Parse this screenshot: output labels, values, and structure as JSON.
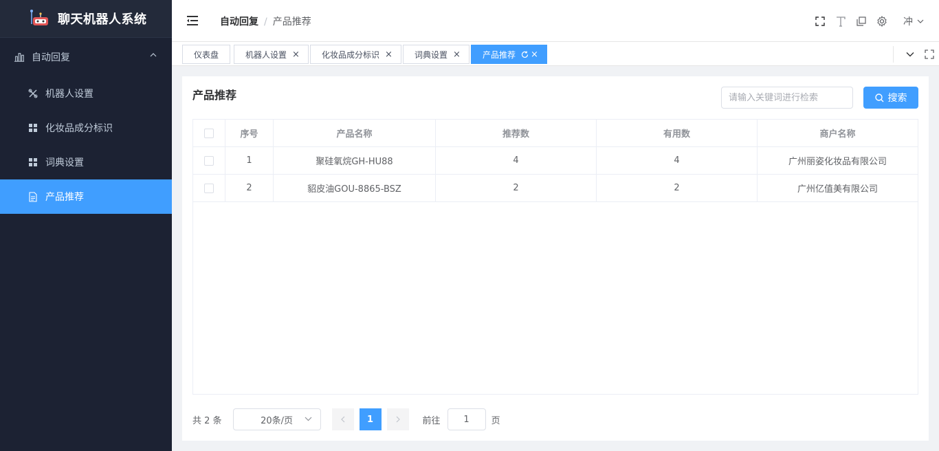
{
  "app": {
    "title": "聊天机器人系统"
  },
  "sidebar": {
    "group": {
      "label": "自动回复"
    },
    "items": [
      {
        "label": "机器人设置",
        "icon": "wrench-icon"
      },
      {
        "label": "化妆品成分标识",
        "icon": "grid-icon"
      },
      {
        "label": "词典设置",
        "icon": "grid-icon"
      },
      {
        "label": "产品推荐",
        "icon": "document-icon",
        "active": true
      }
    ]
  },
  "header": {
    "breadcrumb": [
      "自动回复",
      "产品推荐"
    ],
    "breadcrumb_sep": "/",
    "user": "冲"
  },
  "tags": [
    {
      "label": "仪表盘"
    },
    {
      "label": "机器人设置",
      "close": "×"
    },
    {
      "label": "化妆品成分标识",
      "close": "×"
    },
    {
      "label": "词典设置",
      "close": "×"
    },
    {
      "label": "产品推荐",
      "close": "×",
      "active": true
    }
  ],
  "main": {
    "title": "产品推荐",
    "search": {
      "placeholder": "请输入关键词进行检索",
      "button": "搜索"
    },
    "table": {
      "headers": [
        "序号",
        "产品名称",
        "推荐数",
        "有用数",
        "商户名称"
      ],
      "rows": [
        [
          "1",
          "聚硅氧烷GH-HU88",
          "4",
          "4",
          "广州丽姿化妆品有限公司"
        ],
        [
          "2",
          "貂皮油GOU-8865-BSZ",
          "2",
          "2",
          "广州亿值美有限公司"
        ]
      ]
    },
    "pagination": {
      "total": "共 2 条",
      "page_size": "20条/页",
      "current": "1",
      "goto_label": "前往",
      "goto_value": "1",
      "page_suffix": "页"
    }
  },
  "colors": {
    "accent": "#409eff",
    "sidebar_bg": "#1c2233"
  }
}
